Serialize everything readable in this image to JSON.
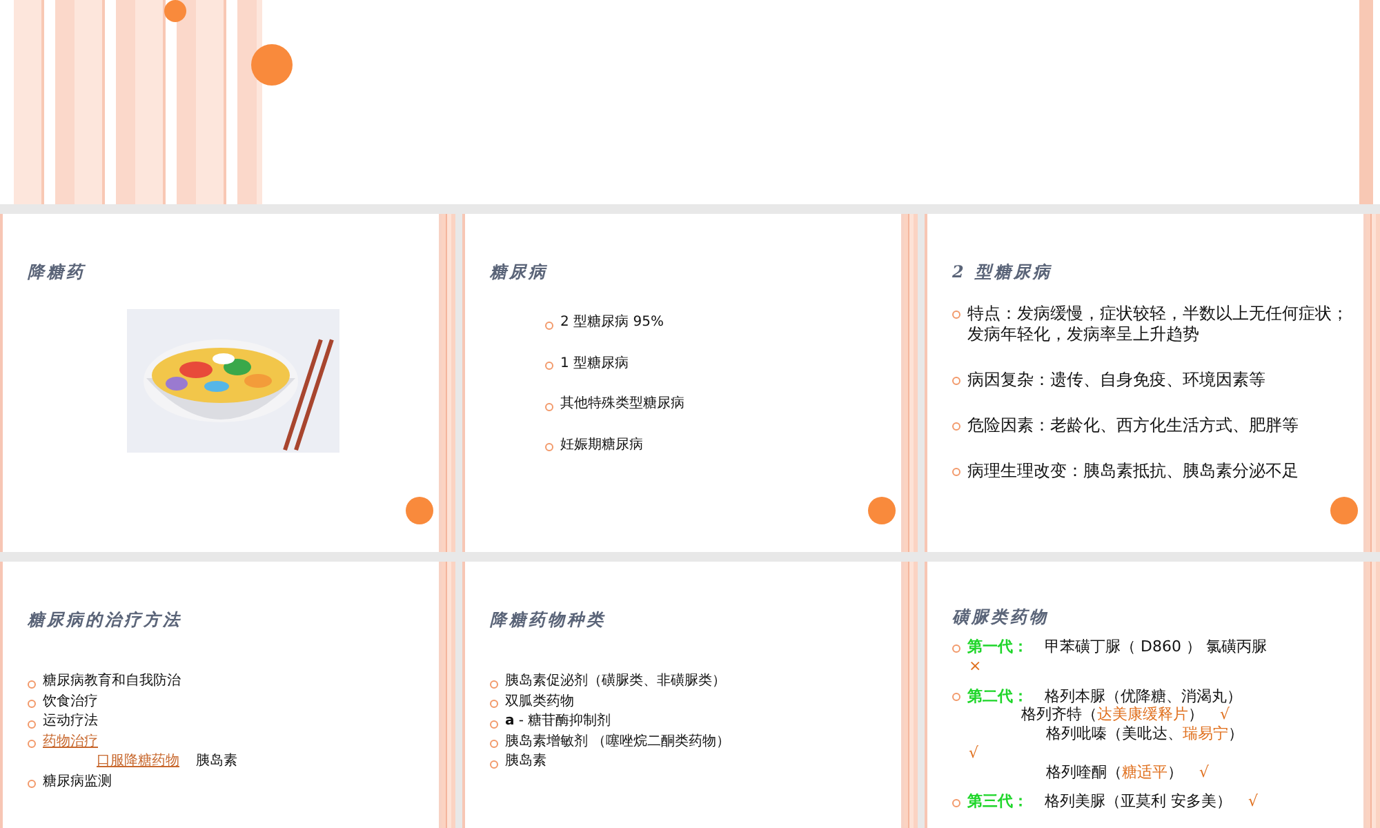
{
  "slides": [
    {
      "kind": "cover"
    },
    {
      "kind": "picture",
      "title": "降糖药",
      "ornament": true
    },
    {
      "kind": "list-wide",
      "title": "糖尿病",
      "ornament": true,
      "items": [
        {
          "kind": "bullet",
          "segments": [
            {
              "text": "2 型糖尿病   95%"
            }
          ]
        },
        {
          "kind": "bullet",
          "segments": [
            {
              "text": "1 型糖尿病"
            }
          ]
        },
        {
          "kind": "bullet",
          "segments": [
            {
              "text": "其他特殊类型糖尿病"
            }
          ]
        },
        {
          "kind": "bullet",
          "segments": [
            {
              "text": "妊娠期糖尿病"
            }
          ]
        }
      ]
    },
    {
      "kind": "list-large",
      "title": "2 型糖尿病",
      "ornament": true,
      "items": [
        {
          "kind": "bullet",
          "segments": [
            {
              "text": "特点：发病缓慢，症状较轻，半数以上无任何症状；发病年轻化，发病率呈上升趋势"
            }
          ]
        },
        {
          "kind": "bullet",
          "segments": [
            {
              "text": "病因复杂：遗传、自身免疫、环境因素等"
            }
          ]
        },
        {
          "kind": "bullet",
          "segments": [
            {
              "text": "危险因素：老龄化、西方化生活方式、肥胖等"
            }
          ]
        },
        {
          "kind": "bullet",
          "segments": [
            {
              "text": "病理生理改变：胰岛素抵抗、胰岛素分泌不足"
            }
          ]
        }
      ]
    },
    {
      "kind": "list-compact",
      "title": "糖尿病的治疗方法",
      "items": [
        {
          "kind": "bullet",
          "segments": [
            {
              "text": "糖尿病教育和自我防治"
            }
          ]
        },
        {
          "kind": "bullet",
          "segments": [
            {
              "text": "饮食治疗"
            }
          ]
        },
        {
          "kind": "bullet",
          "segments": [
            {
              "text": "运动疗法"
            }
          ]
        },
        {
          "kind": "bullet",
          "segments": [
            {
              "text": "药物治疗",
              "kind": "link"
            }
          ]
        },
        {
          "kind": "sub",
          "segments": [
            {
              "text": "口服降糖药物",
              "kind": "link"
            },
            {
              "text": "胰岛素"
            }
          ]
        },
        {
          "kind": "bullet",
          "segments": [
            {
              "text": "糖尿病监测"
            }
          ]
        }
      ]
    },
    {
      "kind": "list-compact",
      "title": "降糖药物种类",
      "items": [
        {
          "kind": "bullet",
          "segments": [
            {
              "text": "胰岛素促泌剂（磺脲类、非磺脲类）"
            }
          ]
        },
        {
          "kind": "bullet",
          "segments": [
            {
              "text": "双胍类药物"
            }
          ]
        },
        {
          "kind": "bullet",
          "segments": [
            {
              "text": "**a** - 糖苷酶抑制剂"
            }
          ]
        },
        {
          "kind": "bullet",
          "segments": [
            {
              "text": "胰岛素增敏剂 （噻唑烷二酮类药物）"
            }
          ]
        },
        {
          "kind": "bullet",
          "segments": [
            {
              "text": "胰岛素"
            }
          ]
        }
      ]
    },
    {
      "kind": "list-rich",
      "title": "磺脲类药物",
      "items": [
        {
          "kind": "bullet",
          "segments": [
            {
              "text": "第一代：",
              "kind": "label"
            },
            {
              "text": "甲苯磺丁脲（ D860 ） 氯磺丙脲"
            }
          ]
        },
        {
          "kind": "tail",
          "segments": [
            {
              "text": "×",
              "kind": "accent"
            }
          ]
        },
        {
          "kind": "bullet",
          "segments": [
            {
              "text": "第二代：",
              "kind": "label"
            },
            {
              "text": "格列本脲（优降糖、消渴丸）"
            }
          ]
        },
        {
          "kind": "sub",
          "segments": [
            {
              "text": "格列齐特（"
            },
            {
              "text": "达美康缓释片",
              "kind": "accent"
            },
            {
              "text": "）"
            },
            {
              "text": "√",
              "kind": "accent"
            }
          ]
        },
        {
          "kind": "subdeep",
          "segments": [
            {
              "text": "格列吡嗪（美吡达、"
            },
            {
              "text": "瑞易宁",
              "kind": "accent"
            },
            {
              "text": "）"
            }
          ]
        },
        {
          "kind": "tail",
          "segments": [
            {
              "text": "√",
              "kind": "accent"
            }
          ]
        },
        {
          "kind": "subdeep",
          "segments": [
            {
              "text": "格列喹酮（"
            },
            {
              "text": "糖适平",
              "kind": "accent"
            },
            {
              "text": "）"
            },
            {
              "text": "√",
              "kind": "accent"
            }
          ]
        },
        {
          "kind": "bullet",
          "segments": [
            {
              "text": "第三代：",
              "kind": "label"
            },
            {
              "text": "格列美脲（亚莫利 安多美）"
            },
            {
              "text": "√",
              "kind": "accent"
            }
          ]
        }
      ]
    }
  ]
}
